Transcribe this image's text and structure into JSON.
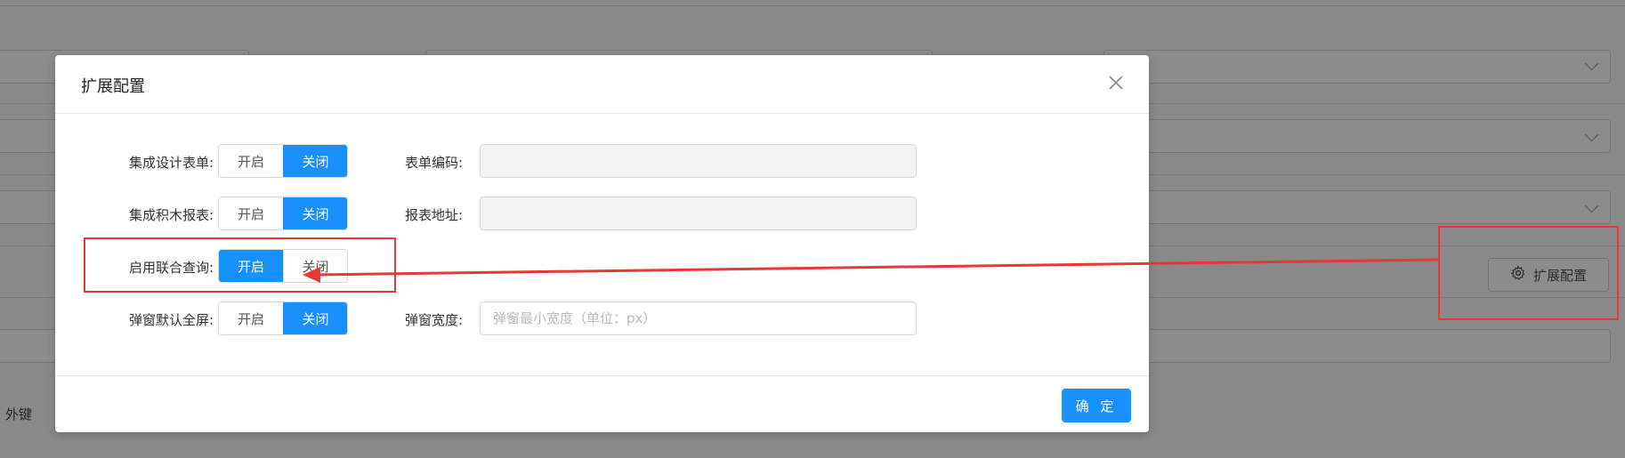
{
  "background": {
    "ext_button_label": "扩展配置",
    "foreign_key_label": "外键"
  },
  "modal": {
    "title": "扩展配置",
    "confirm_label": "确 定",
    "fields": [
      {
        "label": "集成设计表单:",
        "on_label": "开启",
        "off_label": "关闭",
        "value": "关闭"
      },
      {
        "label": "集成积木报表:",
        "on_label": "开启",
        "off_label": "关闭",
        "value": "关闭"
      },
      {
        "label": "启用联合查询:",
        "on_label": "开启",
        "off_label": "关闭",
        "value": "开启"
      },
      {
        "label": "弹窗默认全屏:",
        "on_label": "开启",
        "off_label": "关闭",
        "value": "关闭"
      }
    ],
    "right_fields": [
      {
        "label": "表单编码:",
        "value": "",
        "placeholder": "",
        "disabled": true
      },
      {
        "label": "报表地址:",
        "value": "",
        "placeholder": "",
        "disabled": true
      },
      {
        "label": "弹窗宽度:",
        "value": "",
        "placeholder": "弹窗最小宽度（单位：px）",
        "disabled": false
      }
    ]
  },
  "colors": {
    "primary": "#1890ff",
    "annotation_red": "#e53935"
  }
}
